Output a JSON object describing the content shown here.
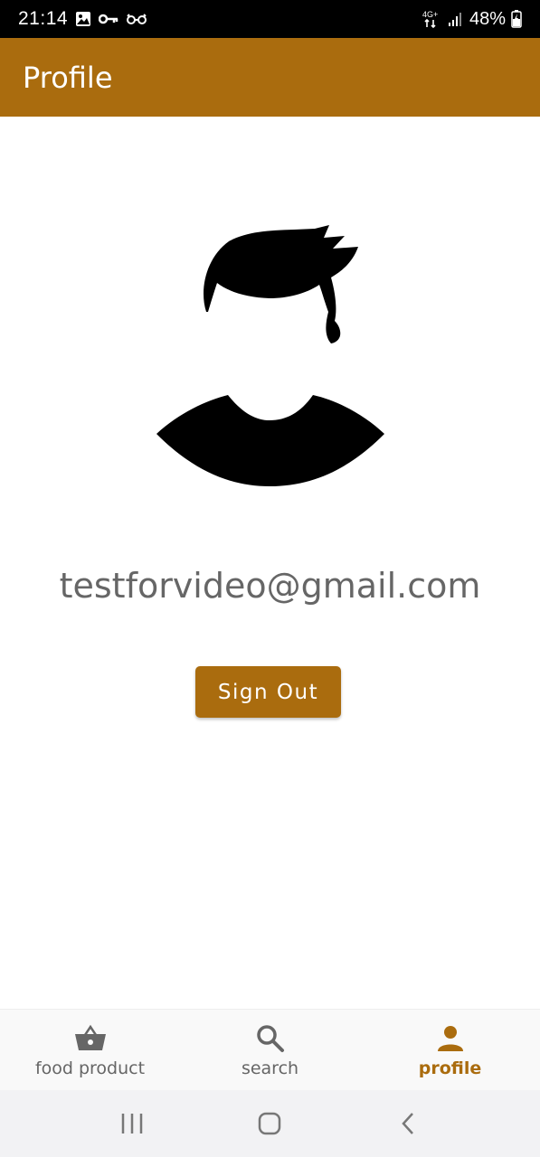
{
  "status_bar": {
    "time": "21:14",
    "network": "4G+",
    "battery": "48%",
    "left_icons": [
      "image-icon",
      "key-icon",
      "glasses-icon"
    ],
    "right_icons": [
      "network-icon",
      "signal-icon",
      "battery-icon"
    ]
  },
  "app_bar": {
    "title": "Profile"
  },
  "profile": {
    "avatar_icon": "user-avatar-icon",
    "email": "testforvideo@gmail.com",
    "sign_out_label": "Sign Out"
  },
  "bottom_nav": {
    "items": [
      {
        "label": "food product",
        "icon": "basket-icon",
        "active": false
      },
      {
        "label": "search",
        "icon": "search-icon",
        "active": false
      },
      {
        "label": "profile",
        "icon": "person-icon",
        "active": true
      }
    ]
  },
  "system_nav": {
    "buttons": [
      "recents-icon",
      "home-icon",
      "back-icon"
    ]
  },
  "colors": {
    "accent": "#AA6C0E",
    "status_bar": "#000000",
    "muted_text": "#666666",
    "background": "#ffffff"
  }
}
